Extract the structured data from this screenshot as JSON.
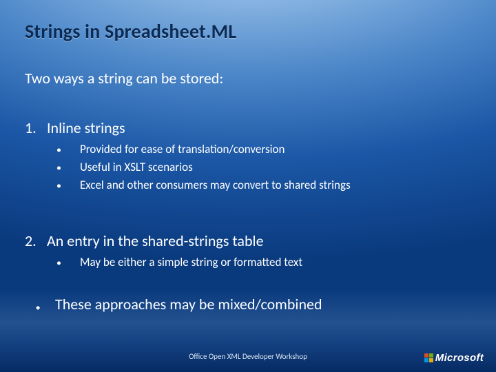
{
  "title": "Strings in Spreadsheet.ML",
  "subtitle": "Two ways a string can be stored:",
  "item1": {
    "num": "1.",
    "heading": "Inline strings",
    "bullets": [
      "Provided for ease of translation/conversion",
      "Useful in XSLT scenarios",
      "Excel and other consumers may convert to shared strings"
    ]
  },
  "item2": {
    "num": "2.",
    "heading": "An entry in the shared-strings table",
    "bullets": [
      "May be either a simple string or formatted text"
    ]
  },
  "final": "These approaches may be mixed/combined",
  "footer": "Office Open XML Developer Workshop",
  "logo": "Microsoft"
}
